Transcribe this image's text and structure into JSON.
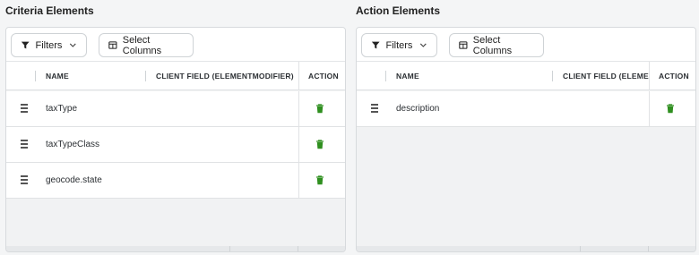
{
  "criteria": {
    "title": "Criteria Elements",
    "toolbar": {
      "filters_label": "Filters",
      "columns_label": "Select Columns"
    },
    "columns": {
      "name": "NAME",
      "client_field": "CLIENT FIELD (ELEMENTMODIFIER)",
      "action": "ACTION"
    },
    "rows": [
      {
        "name": "taxType"
      },
      {
        "name": "taxTypeClass"
      },
      {
        "name": "geocode.state"
      }
    ]
  },
  "action": {
    "title": "Action Elements",
    "toolbar": {
      "filters_label": "Filters",
      "columns_label": "Select Columns"
    },
    "columns": {
      "name": "NAME",
      "client_field": "CLIENT FIELD (ELEMENTMODIFIER)",
      "action": "ACTION"
    },
    "rows": [
      {
        "name": "description"
      }
    ]
  },
  "colors": {
    "delete": "#2f8f1f",
    "border": "#d7dadd",
    "panel_bg": "#f1f2f3"
  },
  "icons": {
    "filter": "filter-icon",
    "columns": "columns-icon",
    "chevron": "chevron-down-icon",
    "drag": "drag-handle-icon",
    "delete": "trash-icon"
  }
}
